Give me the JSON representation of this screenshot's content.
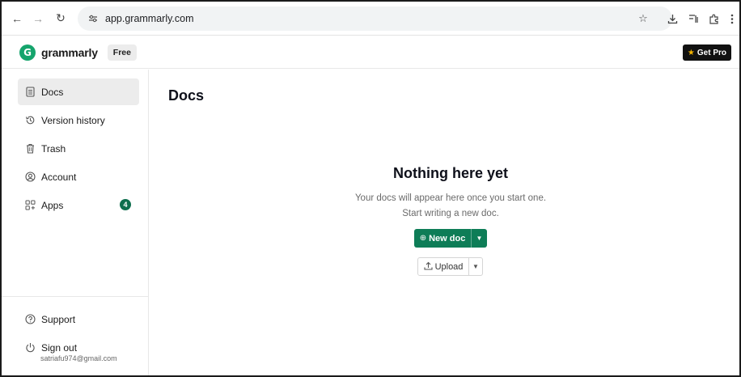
{
  "browser": {
    "url": "app.grammarly.com",
    "icons": [
      "back-icon",
      "forward-icon",
      "reload-icon",
      "site-settings-icon",
      "bookmark-star-icon",
      "download-icon",
      "reading-mode-icon",
      "extensions-icon",
      "menu-icon"
    ]
  },
  "header": {
    "logo_text": "grammarly",
    "logo_glyph": "G",
    "plan_badge": "Free",
    "get_pro_label": "Get Pro",
    "brand_color": "#15a46c"
  },
  "sidebar": {
    "items": [
      {
        "label": "Docs",
        "icon": "document-icon",
        "active": true
      },
      {
        "label": "Version history",
        "icon": "history-icon"
      },
      {
        "label": "Trash",
        "icon": "trash-icon"
      },
      {
        "label": "Account",
        "icon": "account-icon"
      },
      {
        "label": "Apps",
        "icon": "apps-icon",
        "badge": "4"
      }
    ],
    "bottom": {
      "support_label": "Support",
      "signout_label": "Sign out",
      "email": "satriafu974@gmail.com"
    }
  },
  "main": {
    "title": "Docs",
    "empty_title": "Nothing here yet",
    "empty_line1": "Your docs will appear here once you start one.",
    "empty_line2": "Start writing a new doc.",
    "new_doc_label": "New doc",
    "upload_label": "Upload",
    "accent_color": "#0e7d57"
  }
}
